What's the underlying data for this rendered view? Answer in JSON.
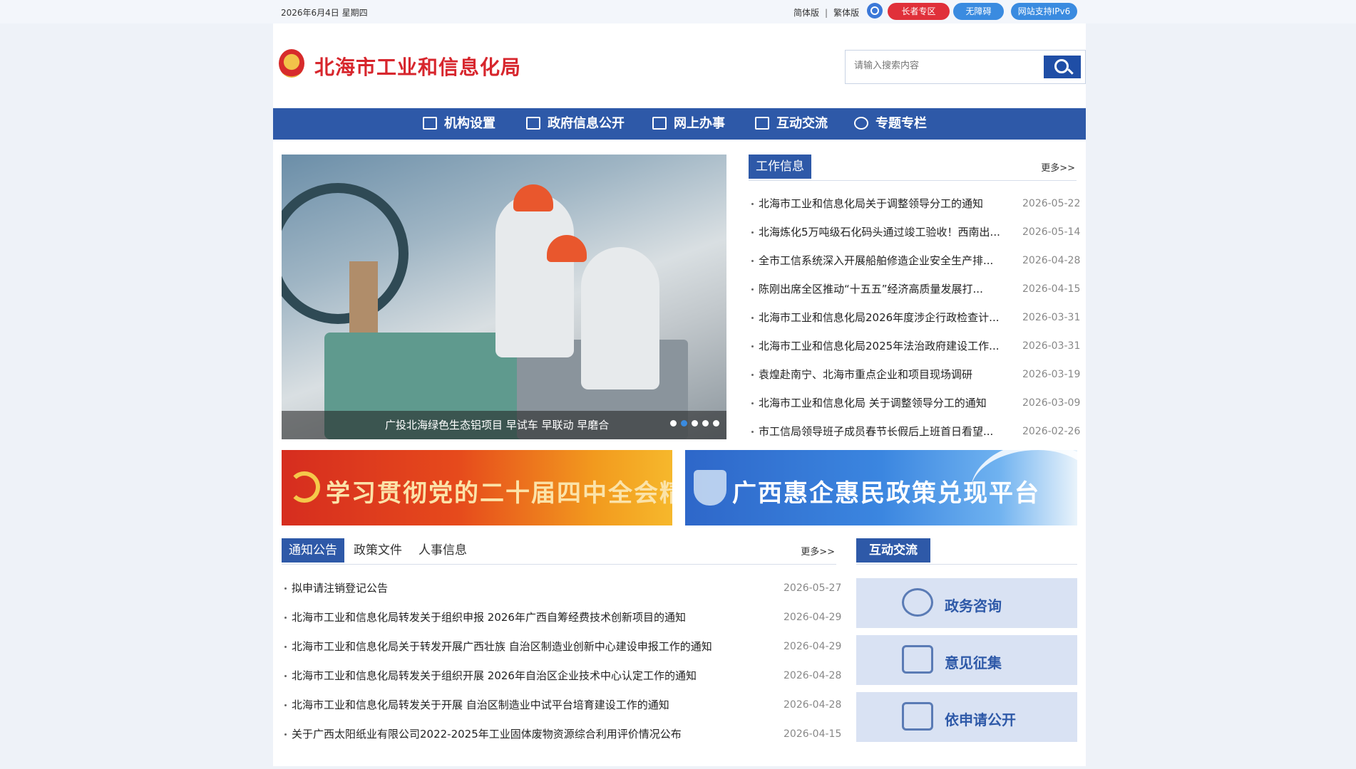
{
  "topbar": {
    "date": "2026年6月4日  星期四",
    "simplified": "简体版",
    "separator": "|",
    "traditional": "繁体版",
    "elder_zone": "长者专区",
    "accessibility": "无障碍",
    "ipv6": "网站支持IPv6"
  },
  "header": {
    "site_title": "北海市工业和信息化局",
    "search_placeholder": "请输入搜索内容"
  },
  "nav": [
    {
      "label": "机构设置",
      "icon": "home-icon"
    },
    {
      "label": "政府信息公开",
      "icon": "image-icon"
    },
    {
      "label": "网上办事",
      "icon": "print-icon"
    },
    {
      "label": "互动交流",
      "icon": "laptop-icon"
    },
    {
      "label": "专题专栏",
      "icon": "chat-bubble-icon"
    }
  ],
  "slider": {
    "caption": "广投北海绿色生态铝项目 早试车 早联动 早磨合",
    "dot_count": 5,
    "active_dot": 2
  },
  "work_info": {
    "title": "工作信息",
    "more": "更多>>",
    "items": [
      {
        "title": "北海市工业和信息化局关于调整领导分工的通知",
        "date": "2026-05-22"
      },
      {
        "title": "北海炼化5万吨级石化码头通过竣工验收！西南出...",
        "date": "2026-05-14"
      },
      {
        "title": "全市工信系统深入开展船舶修造企业安全生产排...",
        "date": "2026-04-28"
      },
      {
        "title": "陈刚出席全区推动“十五五”经济高质量发展打...",
        "date": "2026-04-15"
      },
      {
        "title": "北海市工业和信息化局2026年度涉企行政检查计...",
        "date": "2026-03-31"
      },
      {
        "title": "北海市工业和信息化局2025年法治政府建设工作...",
        "date": "2026-03-31"
      },
      {
        "title": "袁煌赴南宁、北海市重点企业和项目现场调研",
        "date": "2026-03-19"
      },
      {
        "title": "北海市工业和信息化局 关于调整领导分工的通知",
        "date": "2026-03-09"
      },
      {
        "title": "市工信局领导班子成员春节长假后上班首日看望...",
        "date": "2026-02-26"
      }
    ]
  },
  "banners": {
    "left": "学习贯彻党的二十届四中全会精神",
    "right": "广西惠企惠民政策兑现平台"
  },
  "notices": {
    "tabs": [
      "通知公告",
      "政策文件",
      "人事信息"
    ],
    "more": "更多>>",
    "items": [
      {
        "title": "拟申请注销登记公告",
        "date": "2026-05-27"
      },
      {
        "title": "北海市工业和信息化局转发关于组织申报 2026年广西自筹经费技术创新项目的通知",
        "date": "2026-04-29"
      },
      {
        "title": "北海市工业和信息化局关于转发开展广西壮族 自治区制造业创新中心建设申报工作的通知",
        "date": "2026-04-29"
      },
      {
        "title": "北海市工业和信息化局转发关于组织开展 2026年自治区企业技术中心认定工作的通知",
        "date": "2026-04-28"
      },
      {
        "title": "北海市工业和信息化局转发关于开展 自治区制造业中试平台培育建设工作的通知",
        "date": "2026-04-28"
      },
      {
        "title": "关于广西太阳纸业有限公司2022-2025年工业固体废物资源综合利用评价情况公布",
        "date": "2026-04-15"
      }
    ]
  },
  "interaction": {
    "title": "互动交流",
    "buttons": [
      {
        "label": "政务咨询",
        "icon": "envelope-icon"
      },
      {
        "label": "意见征集",
        "icon": "message-icon"
      },
      {
        "label": "依申请公开",
        "icon": "message-icon"
      }
    ]
  },
  "colors": {
    "primary": "#2e59a8",
    "title_red": "#d7262d",
    "elder_red": "#e0303a",
    "accent_blue": "#3a8be0",
    "interact_bg": "#d9e2f3"
  }
}
